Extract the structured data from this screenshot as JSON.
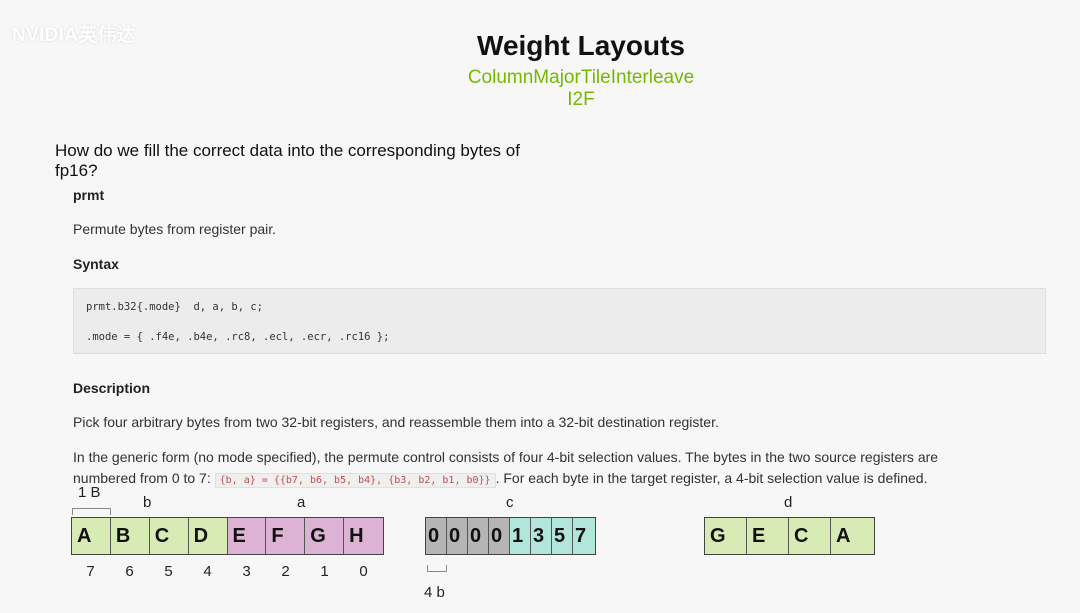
{
  "watermark": "NVIDIA英伟达",
  "slide": {
    "title": "Weight Layouts",
    "subtitle1": "ColumnMajorTileInterleave",
    "subtitle2": "I2F",
    "question": "How do we fill the correct data into the corresponding bytes of fp16?"
  },
  "doc": {
    "instr": "prmt",
    "summary": "Permute bytes from register pair.",
    "syntax_heading": "Syntax",
    "code_line1": "prmt.b32{.mode}  d, a, b, c;",
    "code_line2": ".mode = { .f4e, .b4e, .rc8, .ecl, .ecr, .rc16 };",
    "desc_heading": "Description",
    "desc1": "Pick four arbitrary bytes from two 32-bit registers, and reassemble them into a 32-bit destination register.",
    "desc2": "In the generic form (no mode specified), the permute control consists of four 4-bit selection values. The bytes in the two source registers are",
    "desc3_pre": "numbered from 0 to 7: ",
    "desc3_code": "{b, a} = {{b7, b6, b5, b4}, {b3, b2, b1, b0}}",
    "desc3_post": ". For each byte in the target register, a 4-bit selection value is defined."
  },
  "diagram": {
    "label_1B": "1 B",
    "label_b": "b",
    "label_a": "a",
    "label_c": "c",
    "label_d": "d",
    "label_4b": "4 b",
    "ba_cells": [
      "A",
      "B",
      "C",
      "D",
      "E",
      "F",
      "G",
      "H"
    ],
    "ba_indices": [
      "7",
      "6",
      "5",
      "4",
      "3",
      "2",
      "1",
      "0"
    ],
    "c_cells": [
      "0",
      "0",
      "0",
      "0",
      "1",
      "3",
      "5",
      "7"
    ],
    "d_cells": [
      "G",
      "E",
      "C",
      "A"
    ],
    "colors": {
      "green": "#d9ebb5",
      "pink": "#dcb3d5",
      "gray": "#b5b5b5",
      "teal": "#b3e6da",
      "accent": "#76b900"
    }
  }
}
